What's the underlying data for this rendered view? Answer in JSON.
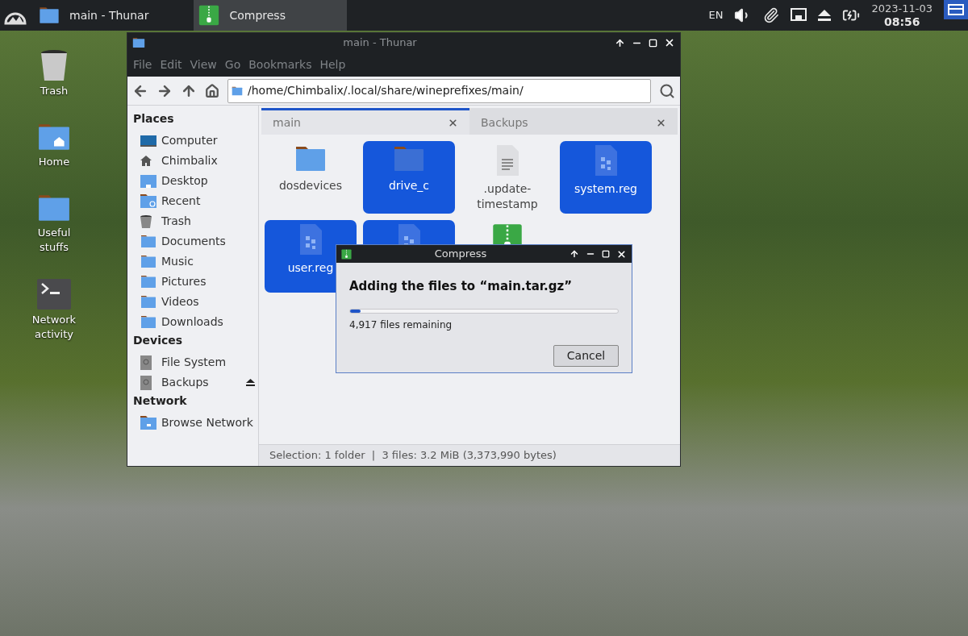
{
  "taskbar": {
    "tasks": [
      {
        "label": "main - Thunar",
        "kind": "folder",
        "selected": false
      },
      {
        "label": "Compress",
        "kind": "archive",
        "selected": true
      }
    ],
    "keyboard_layout": "EN",
    "date": "2023-11-03",
    "time": "08:56"
  },
  "desktop_icons": [
    {
      "label": "Trash",
      "kind": "trash"
    },
    {
      "label": "Home",
      "kind": "home"
    },
    {
      "label": "Useful stuffs",
      "kind": "folder"
    },
    {
      "label": "Network activity",
      "kind": "terminal"
    }
  ],
  "file_manager": {
    "title": "main - Thunar",
    "menu": [
      "File",
      "Edit",
      "View",
      "Go",
      "Bookmarks",
      "Help"
    ],
    "location": "/home/Chimbalix/.local/share/wineprefixes/main/",
    "sidebar": [
      {
        "heading": "Places",
        "items": [
          {
            "label": "Computer",
            "kind": "computer",
            "eject": false
          },
          {
            "label": "Chimbalix",
            "kind": "home",
            "eject": false
          },
          {
            "label": "Desktop",
            "kind": "desktop",
            "eject": false
          },
          {
            "label": "Recent",
            "kind": "recent",
            "eject": false
          },
          {
            "label": "Trash",
            "kind": "trash",
            "eject": false
          },
          {
            "label": "Documents",
            "kind": "folder",
            "eject": false
          },
          {
            "label": "Music",
            "kind": "folder",
            "eject": false
          },
          {
            "label": "Pictures",
            "kind": "folder",
            "eject": false
          },
          {
            "label": "Videos",
            "kind": "folder",
            "eject": false
          },
          {
            "label": "Downloads",
            "kind": "folder",
            "eject": false
          }
        ]
      },
      {
        "heading": "Devices",
        "items": [
          {
            "label": "File System",
            "kind": "drive",
            "eject": false
          },
          {
            "label": "Backups",
            "kind": "drive",
            "eject": true
          }
        ]
      },
      {
        "heading": "Network",
        "items": [
          {
            "label": "Browse Network",
            "kind": "network",
            "eject": false
          }
        ]
      }
    ],
    "tabs": [
      {
        "label": "main",
        "selected": true
      },
      {
        "label": "Backups",
        "selected": false
      }
    ],
    "files": [
      {
        "name": "dosdevices",
        "kind": "folder",
        "selected": false
      },
      {
        "name": "drive_c",
        "kind": "folder",
        "selected": true
      },
      {
        "name": ".update-timestamp",
        "kind": "text",
        "selected": false
      },
      {
        "name": "system.reg",
        "kind": "reg",
        "selected": true
      },
      {
        "name": "user.reg",
        "kind": "reg",
        "selected": true
      },
      {
        "kind": "reg",
        "selected": true
      },
      {
        "kind": "archive",
        "selected": false
      }
    ],
    "status_bar": "Selection: 1 folder  |  3 files: 3.2 MiB (3,373,990 bytes)"
  },
  "dialog": {
    "title": "Compress",
    "heading": "Adding the files to “main.tar.gz”",
    "progress": {
      "level": 0.04
    },
    "status": "4,917 files remaining",
    "buttons": [
      "Cancel"
    ]
  }
}
